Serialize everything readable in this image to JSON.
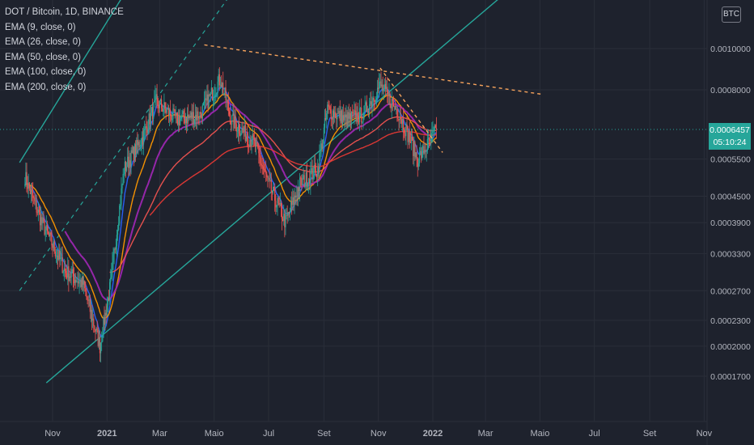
{
  "header": {
    "symbol": "DOT / Bitcoin, 1D, BINANCE",
    "indicators": [
      "EMA (9, close, 0)",
      "EMA (26, close, 0)",
      "EMA (50, close, 0)",
      "EMA (100, close, 0)",
      "EMA (200, close, 0)"
    ],
    "currency_badge": "BTC"
  },
  "last_price": {
    "value": "0.0006457",
    "countdown": "05:10:24"
  },
  "colors": {
    "background": "#1e222d",
    "channel": "#26a69a",
    "trendline": "#f7a35c",
    "up_candle": "#26a69a",
    "down_candle": "#ef5350",
    "ema9": "#2962ff",
    "ema26": "#ff9800",
    "ema50": "#9c27b0",
    "ema100": "#ef5350",
    "ema200": "#e53935"
  },
  "chart_data": {
    "type": "candlestick",
    "scale": "log",
    "y_ticks": [
      "0.0010000",
      "0.0008000",
      "0.0006457",
      "0.0005500",
      "0.0004500",
      "0.0003900",
      "0.0003300",
      "0.0002700",
      "0.0002300",
      "0.0002000",
      "0.0001700"
    ],
    "x_ticks": [
      "Nov",
      "2021",
      "Mar",
      "Maio",
      "Jul",
      "Set",
      "Nov",
      "2022",
      "Mar",
      "Maio",
      "Jul",
      "Set",
      "Nov"
    ],
    "price_anchors": [
      {
        "date": "2020-10-01",
        "close": 0.0005
      },
      {
        "date": "2020-10-20",
        "close": 0.00039
      },
      {
        "date": "2020-11-15",
        "close": 0.0003
      },
      {
        "date": "2020-12-05",
        "close": 0.00028
      },
      {
        "date": "2020-12-24",
        "close": 0.0002
      },
      {
        "date": "2021-01-05",
        "close": 0.00028
      },
      {
        "date": "2021-01-20",
        "close": 0.00052
      },
      {
        "date": "2021-02-10",
        "close": 0.00062
      },
      {
        "date": "2021-02-25",
        "close": 0.00075
      },
      {
        "date": "2021-03-20",
        "close": 0.00068
      },
      {
        "date": "2021-04-15",
        "close": 0.0007
      },
      {
        "date": "2021-05-08",
        "close": 0.00085
      },
      {
        "date": "2021-05-20",
        "close": 0.00068
      },
      {
        "date": "2021-06-15",
        "close": 0.0006
      },
      {
        "date": "2021-07-01",
        "close": 0.00048
      },
      {
        "date": "2021-07-20",
        "close": 0.00039
      },
      {
        "date": "2021-08-05",
        "close": 0.00048
      },
      {
        "date": "2021-08-25",
        "close": 0.00052
      },
      {
        "date": "2021-09-05",
        "close": 0.00072
      },
      {
        "date": "2021-09-25",
        "close": 0.00068
      },
      {
        "date": "2021-10-15",
        "close": 0.0007
      },
      {
        "date": "2021-11-03",
        "close": 0.00082
      },
      {
        "date": "2021-11-25",
        "close": 0.0007
      },
      {
        "date": "2021-12-15",
        "close": 0.00055
      },
      {
        "date": "2021-12-28",
        "close": 0.0006
      },
      {
        "date": "2022-01-05",
        "close": 0.0006457
      }
    ],
    "annotations": [
      {
        "type": "channel_line",
        "from": {
          "date": "2020-09-25",
          "price": 0.00054
        },
        "to": {
          "date": "2021-05-12",
          "price": 0.0032
        }
      },
      {
        "type": "channel_mid",
        "from": {
          "date": "2020-09-25",
          "price": 0.00027
        },
        "to": {
          "date": "2021-09-25",
          "price": 0.0032
        }
      },
      {
        "type": "channel_line",
        "from": {
          "date": "2020-10-25",
          "price": 0.000164
        },
        "to": {
          "date": "2022-10-20",
          "price": 0.0032
        }
      },
      {
        "type": "trendline_dashed",
        "from": {
          "date": "2021-04-20",
          "price": 0.00102
        },
        "to": {
          "date": "2022-05-05",
          "price": 0.00078
        }
      },
      {
        "type": "trendline_dashed",
        "from": {
          "date": "2021-11-03",
          "price": 0.0009
        },
        "to": {
          "date": "2022-01-12",
          "price": 0.00057
        }
      }
    ]
  }
}
